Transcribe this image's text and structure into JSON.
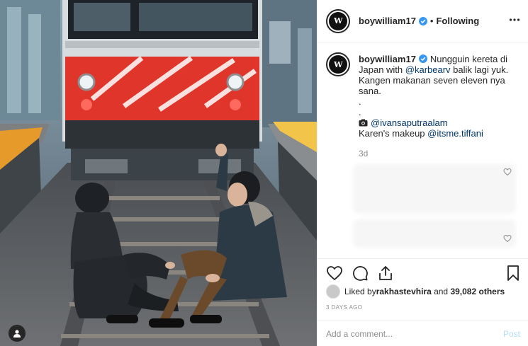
{
  "post": {
    "username": "boywilliam17",
    "avatar_initials": "W",
    "follow_state": "Following",
    "separator": "•"
  },
  "caption": {
    "username": "boywilliam17",
    "line1_pre": "Nungguin kereta di Japan with ",
    "line1_mention": "@karbearv",
    "line1_post": " balik lagi yuk. Kangen makanan seven eleven nya sana.",
    "dot1": ".",
    "dot2": ".",
    "photo_credit_mention": "@ivansaputraalam",
    "makeup_pre": "Karen's makeup ",
    "makeup_mention": "@itsme.tiffani"
  },
  "timestamp_relative": "3d",
  "likes": {
    "prefix": "Liked by ",
    "user": "rakhastevhira",
    "middle": " and ",
    "count": "39,082 others"
  },
  "date": "3 DAYS AGO",
  "comment": {
    "placeholder": "Add a comment...",
    "post_label": "Post"
  },
  "icons": {
    "verified": "verified-badge-icon",
    "more": "more-options-icon",
    "like": "heart-icon",
    "comment": "comment-icon",
    "share": "share-icon",
    "save": "bookmark-icon",
    "tag": "user-tag-icon"
  },
  "colors": {
    "verified_blue": "#3897f0",
    "mention": "#00376b",
    "muted": "#8e8e8e",
    "post_disabled": "#b2dffc",
    "train_red": "#e0352b"
  }
}
